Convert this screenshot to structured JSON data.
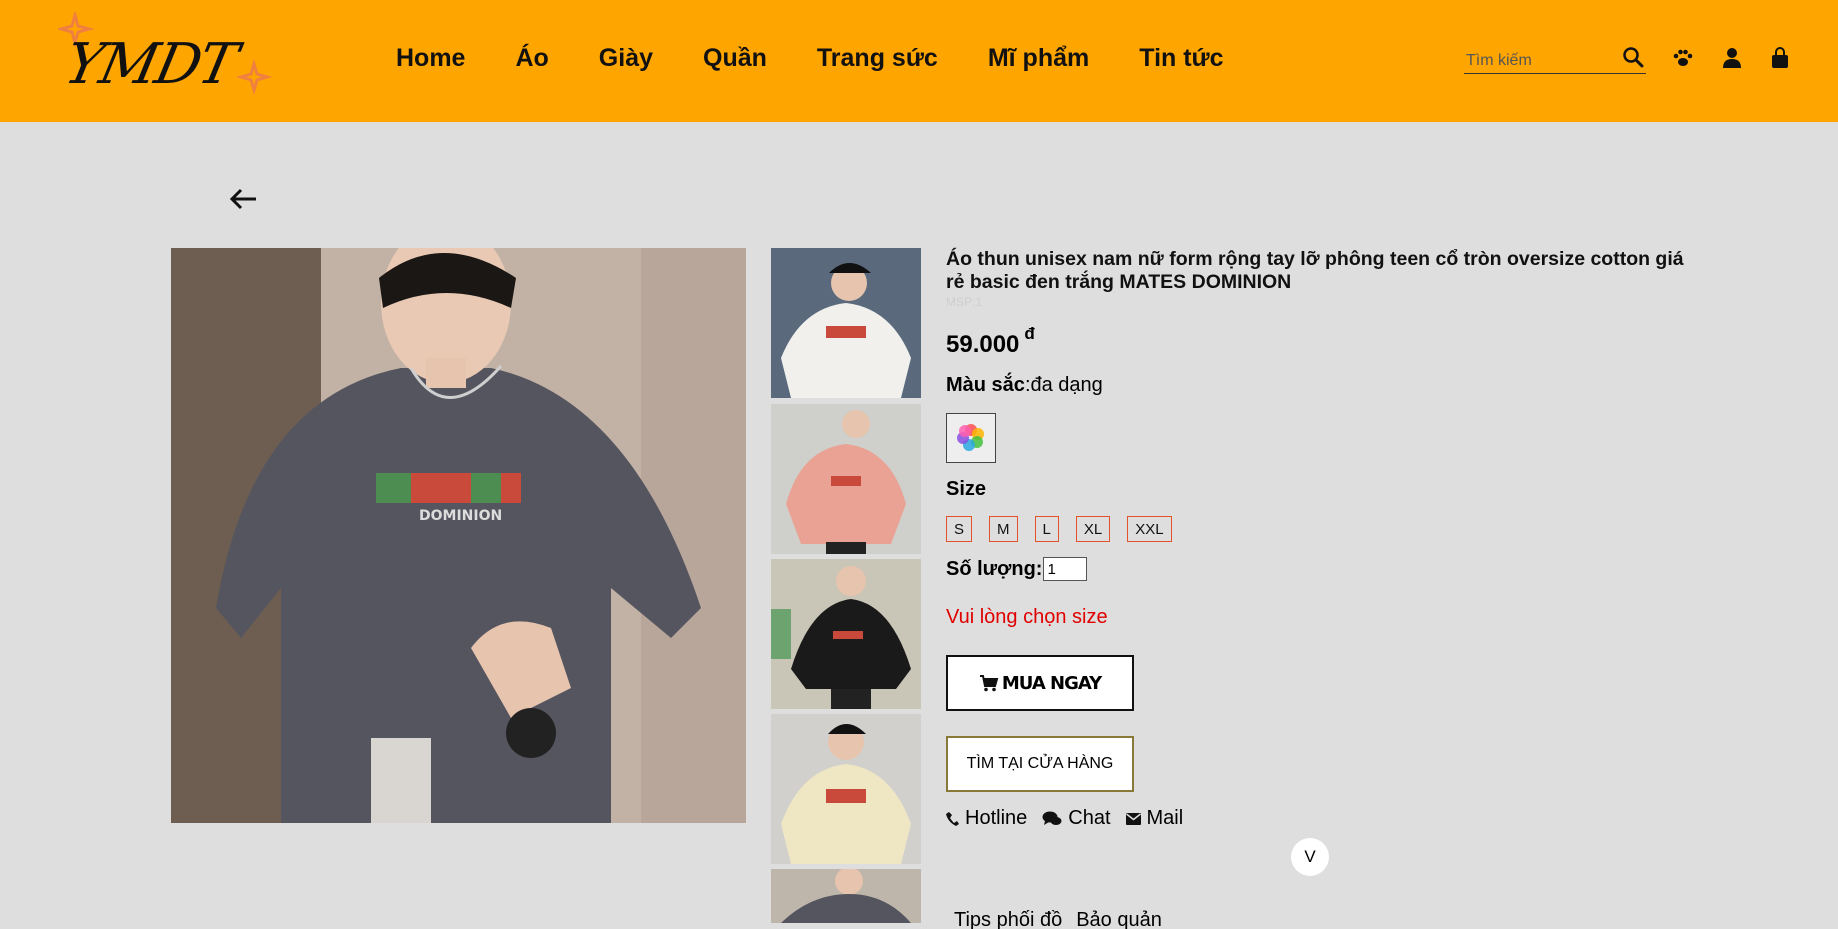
{
  "brand": {
    "logo_text": "YMDT"
  },
  "nav": {
    "items": [
      "Home",
      "Áo",
      "Giày",
      "Quần",
      "Trang sức",
      "Mĩ phẩm",
      "Tin tức"
    ]
  },
  "search": {
    "placeholder": "Tìm kiếm"
  },
  "header_icons": [
    "search-icon",
    "paw-icon",
    "user-icon",
    "shopping-bag-icon"
  ],
  "colors": {
    "header": "#ffa500",
    "page": "#dedede",
    "warning": "#e00000",
    "size_border": "#e0532b"
  },
  "product": {
    "title": "Áo thun unisex nam nữ form rộng tay lỡ phông teen cổ tròn oversize cotton giá rẻ basic đen trắng MATES DOMINION",
    "sku": "MSP:1",
    "price": "59.000",
    "currency": "đ",
    "color_label": "Màu sắc",
    "color_value": ":đa dạng",
    "size_label": "Size",
    "sizes": [
      "S",
      "M",
      "L",
      "XL",
      "XXL"
    ],
    "qty_label": "Số lượng:",
    "qty_value": "1",
    "warning": "Vui lòng chọn size",
    "buy_label": "MUA NGAY",
    "find_label": "TÌM TẠI CỬA HÀNG",
    "contacts": [
      "Hotline",
      "Chat",
      "Mail"
    ],
    "toggle_label": "V",
    "tabs": [
      "Tips phối đồ",
      "Bảo quản"
    ]
  },
  "thumbnails": [
    "white shirt",
    "pink shirt",
    "black shirt",
    "cream shirt",
    "grey shirt"
  ]
}
